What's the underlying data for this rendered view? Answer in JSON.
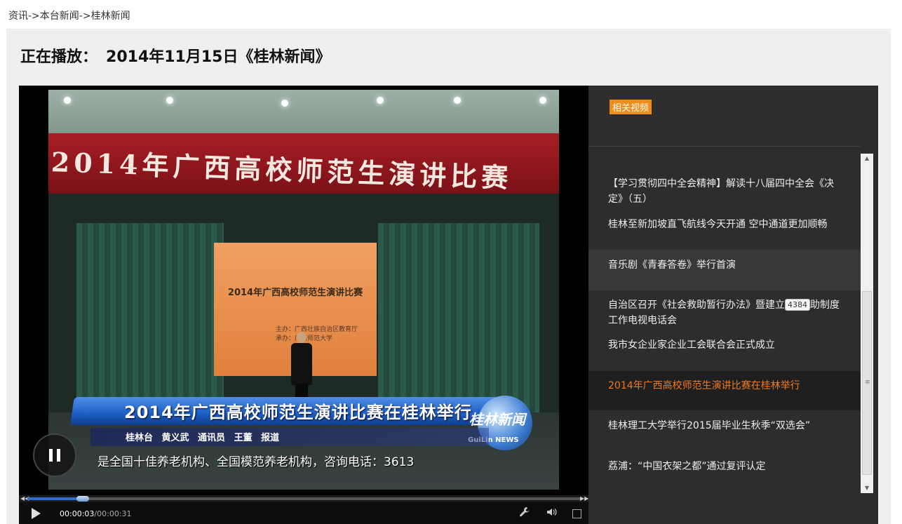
{
  "breadcrumb": "资讯->本台新闻->桂林新闻",
  "now_playing": {
    "label": "正在播放：",
    "title": "2014年11月15日《桂林新闻》"
  },
  "video": {
    "banner_text": "2014年广西高校师范生演讲比赛",
    "screen_title": "2014年广西高校师范生演讲比赛",
    "screen_sub": [
      "主办：广西壮族自治区教育厅",
      "承办：广西师范大学"
    ],
    "lower_third": "2014年广西高校师范生演讲比赛在桂林举行",
    "logo_text": "桂林新闻",
    "logo_en": "GuiLin NEWS",
    "credits": "桂林台 黄义武 通讯员 王董 报道",
    "ticker": "是全国十佳养老机构、全国模范养老机构，咨询电话：3613"
  },
  "controls": {
    "current_time": "00:00:03",
    "total_time": "/00:00:31",
    "progress": 0.1,
    "icons": [
      "play-icon",
      "wrench-icon",
      "volume-icon",
      "fullscreen-icon"
    ]
  },
  "sidebar": {
    "tag": "相关视频",
    "items": [
      {
        "title": "【学习贯彻四中全会精神】解读十八届四中全会《决定》（五）"
      },
      {
        "title": "桂林至新加坡直飞航线今天开通 空中通道更加顺畅"
      },
      {
        "title": "音乐剧《青春答卷》举行首演"
      },
      {
        "title_a": "自治区召开《社会救助暂行办法》暨建立",
        "tooltip": "4384",
        "title_b": "助制度工作电视电话会"
      },
      {
        "title": "我市女企业家企业工会联合会正式成立"
      },
      {
        "title": "2014年广西高校师范生演讲比赛在桂林举行"
      },
      {
        "title": "桂林理工大学举行2015届毕业生秋季“双选会”"
      },
      {
        "title": "荔浦：“中国衣架之都”通过复评认定"
      }
    ]
  },
  "colors": {
    "accent": "#f08c1a",
    "active_text": "#f07a1f",
    "seek": "#2a6fd0"
  }
}
